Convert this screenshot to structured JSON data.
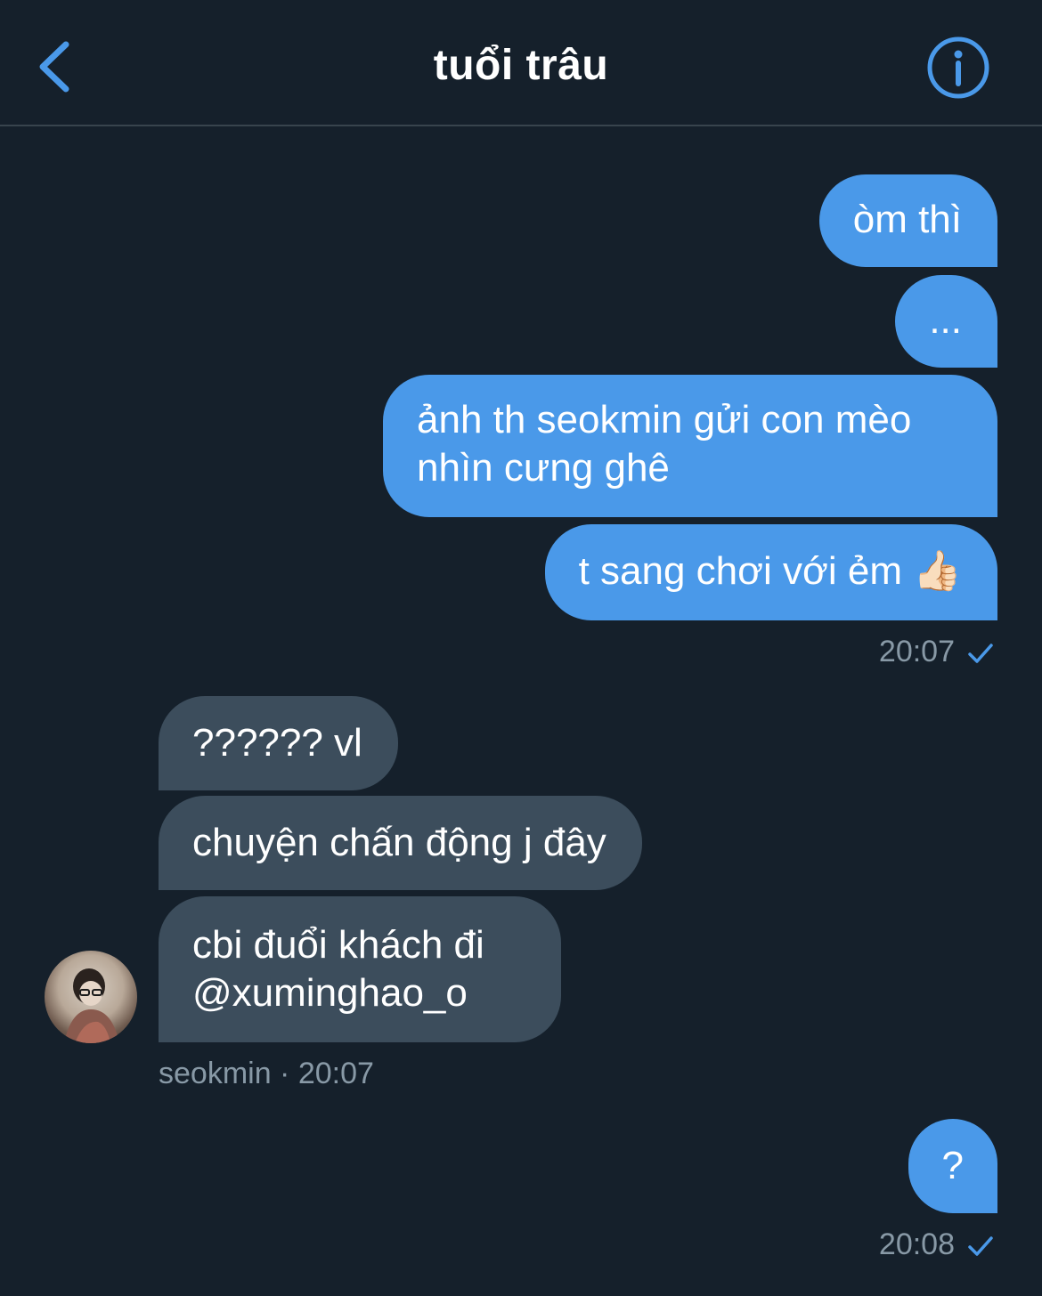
{
  "header": {
    "title": "tuổi trâu",
    "accent_color": "#4a99e9",
    "back_icon": "chevron-left-icon",
    "info_icon": "info-circle-icon"
  },
  "messages": [
    {
      "direction": "sent",
      "text": "òm thì"
    },
    {
      "direction": "sent",
      "text": "..."
    },
    {
      "direction": "sent",
      "text_lines": [
        "ảnh th seokmin gửi con mèo",
        "nhìn cưng ghê"
      ]
    },
    {
      "direction": "sent",
      "text": "t sang chơi với ẻm 👍🏻"
    },
    {
      "direction": "recv",
      "text": "?????? vl"
    },
    {
      "direction": "recv",
      "text": "chuyện chấn động j đây"
    },
    {
      "direction": "recv",
      "text_lines": [
        "cbi đuổi khách đi",
        "@xuminghao_o"
      ]
    },
    {
      "direction": "sent",
      "text": "?"
    }
  ],
  "meta": {
    "sent_time_1": "20:07",
    "recv_sender_time": "seokmin · 20:07",
    "sent_time_2": "20:08"
  },
  "colors": {
    "background": "#15202b",
    "sent_bubble": "#4a99e9",
    "recv_bubble": "#3c4d5c",
    "meta_text": "#8899a6"
  }
}
